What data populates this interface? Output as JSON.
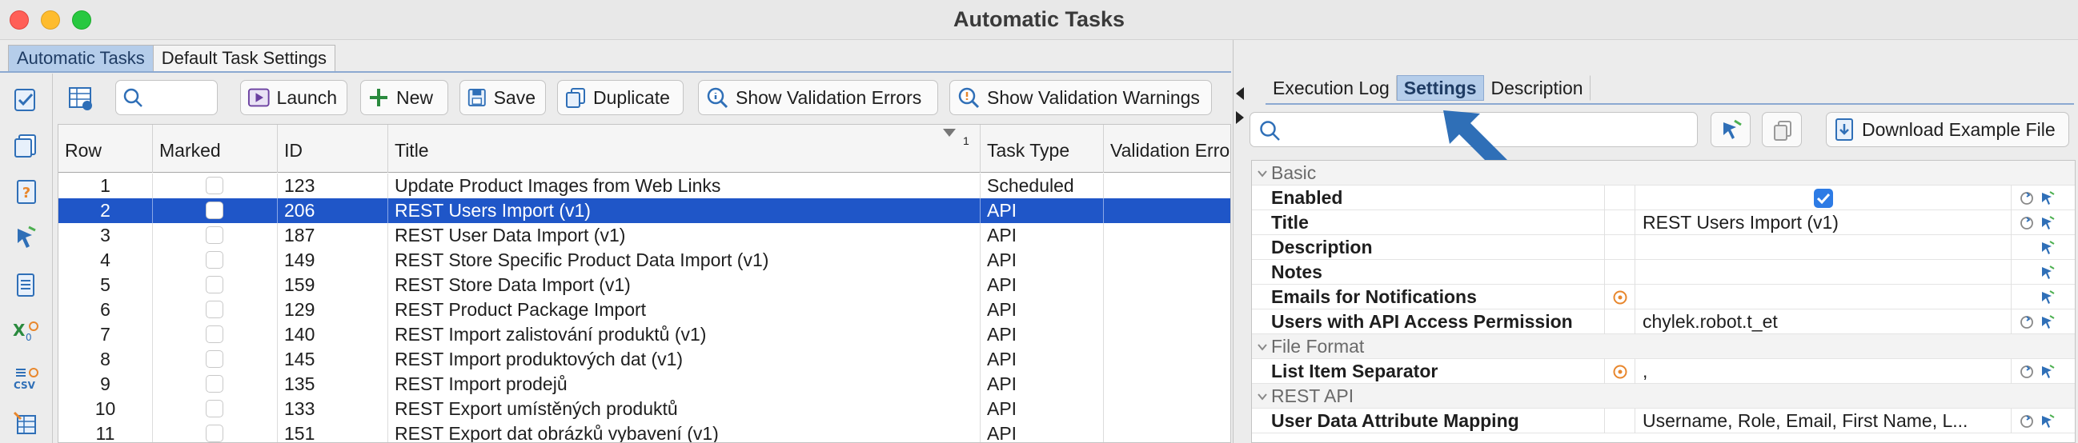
{
  "window": {
    "title": "Automatic Tasks"
  },
  "main_tabs": [
    {
      "label": "Automatic Tasks",
      "active": true
    },
    {
      "label": "Default Task Settings",
      "active": false
    }
  ],
  "toolbar": {
    "search_placeholder": "",
    "launch": "Launch",
    "new": "New",
    "save": "Save",
    "duplicate": "Duplicate",
    "show_validation_errors": "Show Validation Errors",
    "show_validation_warnings": "Show Validation Warnings"
  },
  "grid": {
    "columns": [
      "Row",
      "Marked",
      "ID",
      "Title",
      "Task Type",
      "Validation Error"
    ],
    "sort_indicator": "1",
    "rows": [
      {
        "row": "1",
        "id": "123",
        "title": "Update Product Images from Web Links",
        "type": "Scheduled",
        "selected": false
      },
      {
        "row": "2",
        "id": "206",
        "title": "REST Users Import (v1)",
        "type": "API",
        "selected": true
      },
      {
        "row": "3",
        "id": "187",
        "title": "REST User Data Import (v1)",
        "type": "API",
        "selected": false
      },
      {
        "row": "4",
        "id": "149",
        "title": "REST Store Specific Product Data Import (v1)",
        "type": "API",
        "selected": false
      },
      {
        "row": "5",
        "id": "159",
        "title": "REST Store Data Import (v1)",
        "type": "API",
        "selected": false
      },
      {
        "row": "6",
        "id": "129",
        "title": "REST Product Package Import",
        "type": "API",
        "selected": false
      },
      {
        "row": "7",
        "id": "140",
        "title": "REST Import zalistování produktů (v1)",
        "type": "API",
        "selected": false
      },
      {
        "row": "8",
        "id": "145",
        "title": "REST Import produktových dat (v1)",
        "type": "API",
        "selected": false
      },
      {
        "row": "9",
        "id": "135",
        "title": "REST Import prodejů",
        "type": "API",
        "selected": false
      },
      {
        "row": "10",
        "id": "133",
        "title": "REST Export umístěných produktů",
        "type": "API",
        "selected": false
      },
      {
        "row": "11",
        "id": "151",
        "title": "REST Export dat obrázků vybavení (v1)",
        "type": "API",
        "selected": false
      }
    ]
  },
  "right_panel": {
    "tabs": [
      {
        "label": "Execution Log",
        "active": false
      },
      {
        "label": "Settings",
        "active": true
      },
      {
        "label": "Description",
        "active": false
      }
    ],
    "search_placeholder": "",
    "download_button": "Download Example File",
    "properties": [
      {
        "kind": "section",
        "name": "Basic"
      },
      {
        "kind": "prop",
        "name": "Enabled",
        "value": "",
        "checkbox": true,
        "checked": true,
        "warn": false
      },
      {
        "kind": "prop",
        "name": "Title",
        "value": "REST Users Import (v1)",
        "warn": false
      },
      {
        "kind": "prop",
        "name": "Description",
        "value": "",
        "warn": false
      },
      {
        "kind": "prop",
        "name": "Notes",
        "value": "",
        "warn": false
      },
      {
        "kind": "prop",
        "name": "Emails for Notifications",
        "value": "",
        "warn": true
      },
      {
        "kind": "prop",
        "name": "Users with API Access Permission",
        "value": "chylek.robot.t_et",
        "warn": false
      },
      {
        "kind": "section",
        "name": "File Format"
      },
      {
        "kind": "prop",
        "name": "List Item Separator",
        "value": ",",
        "warn": true
      },
      {
        "kind": "section",
        "name": "REST API"
      },
      {
        "kind": "prop",
        "name": "User Data Attribute Mapping",
        "value": "Username, Role, Email, First Name, L...",
        "warn": false
      }
    ]
  },
  "colors": {
    "selection": "#1f56c8",
    "active_tab": "#b5cdea",
    "arrow": "#2f6fb7",
    "warn_icon": "#e8872d"
  }
}
